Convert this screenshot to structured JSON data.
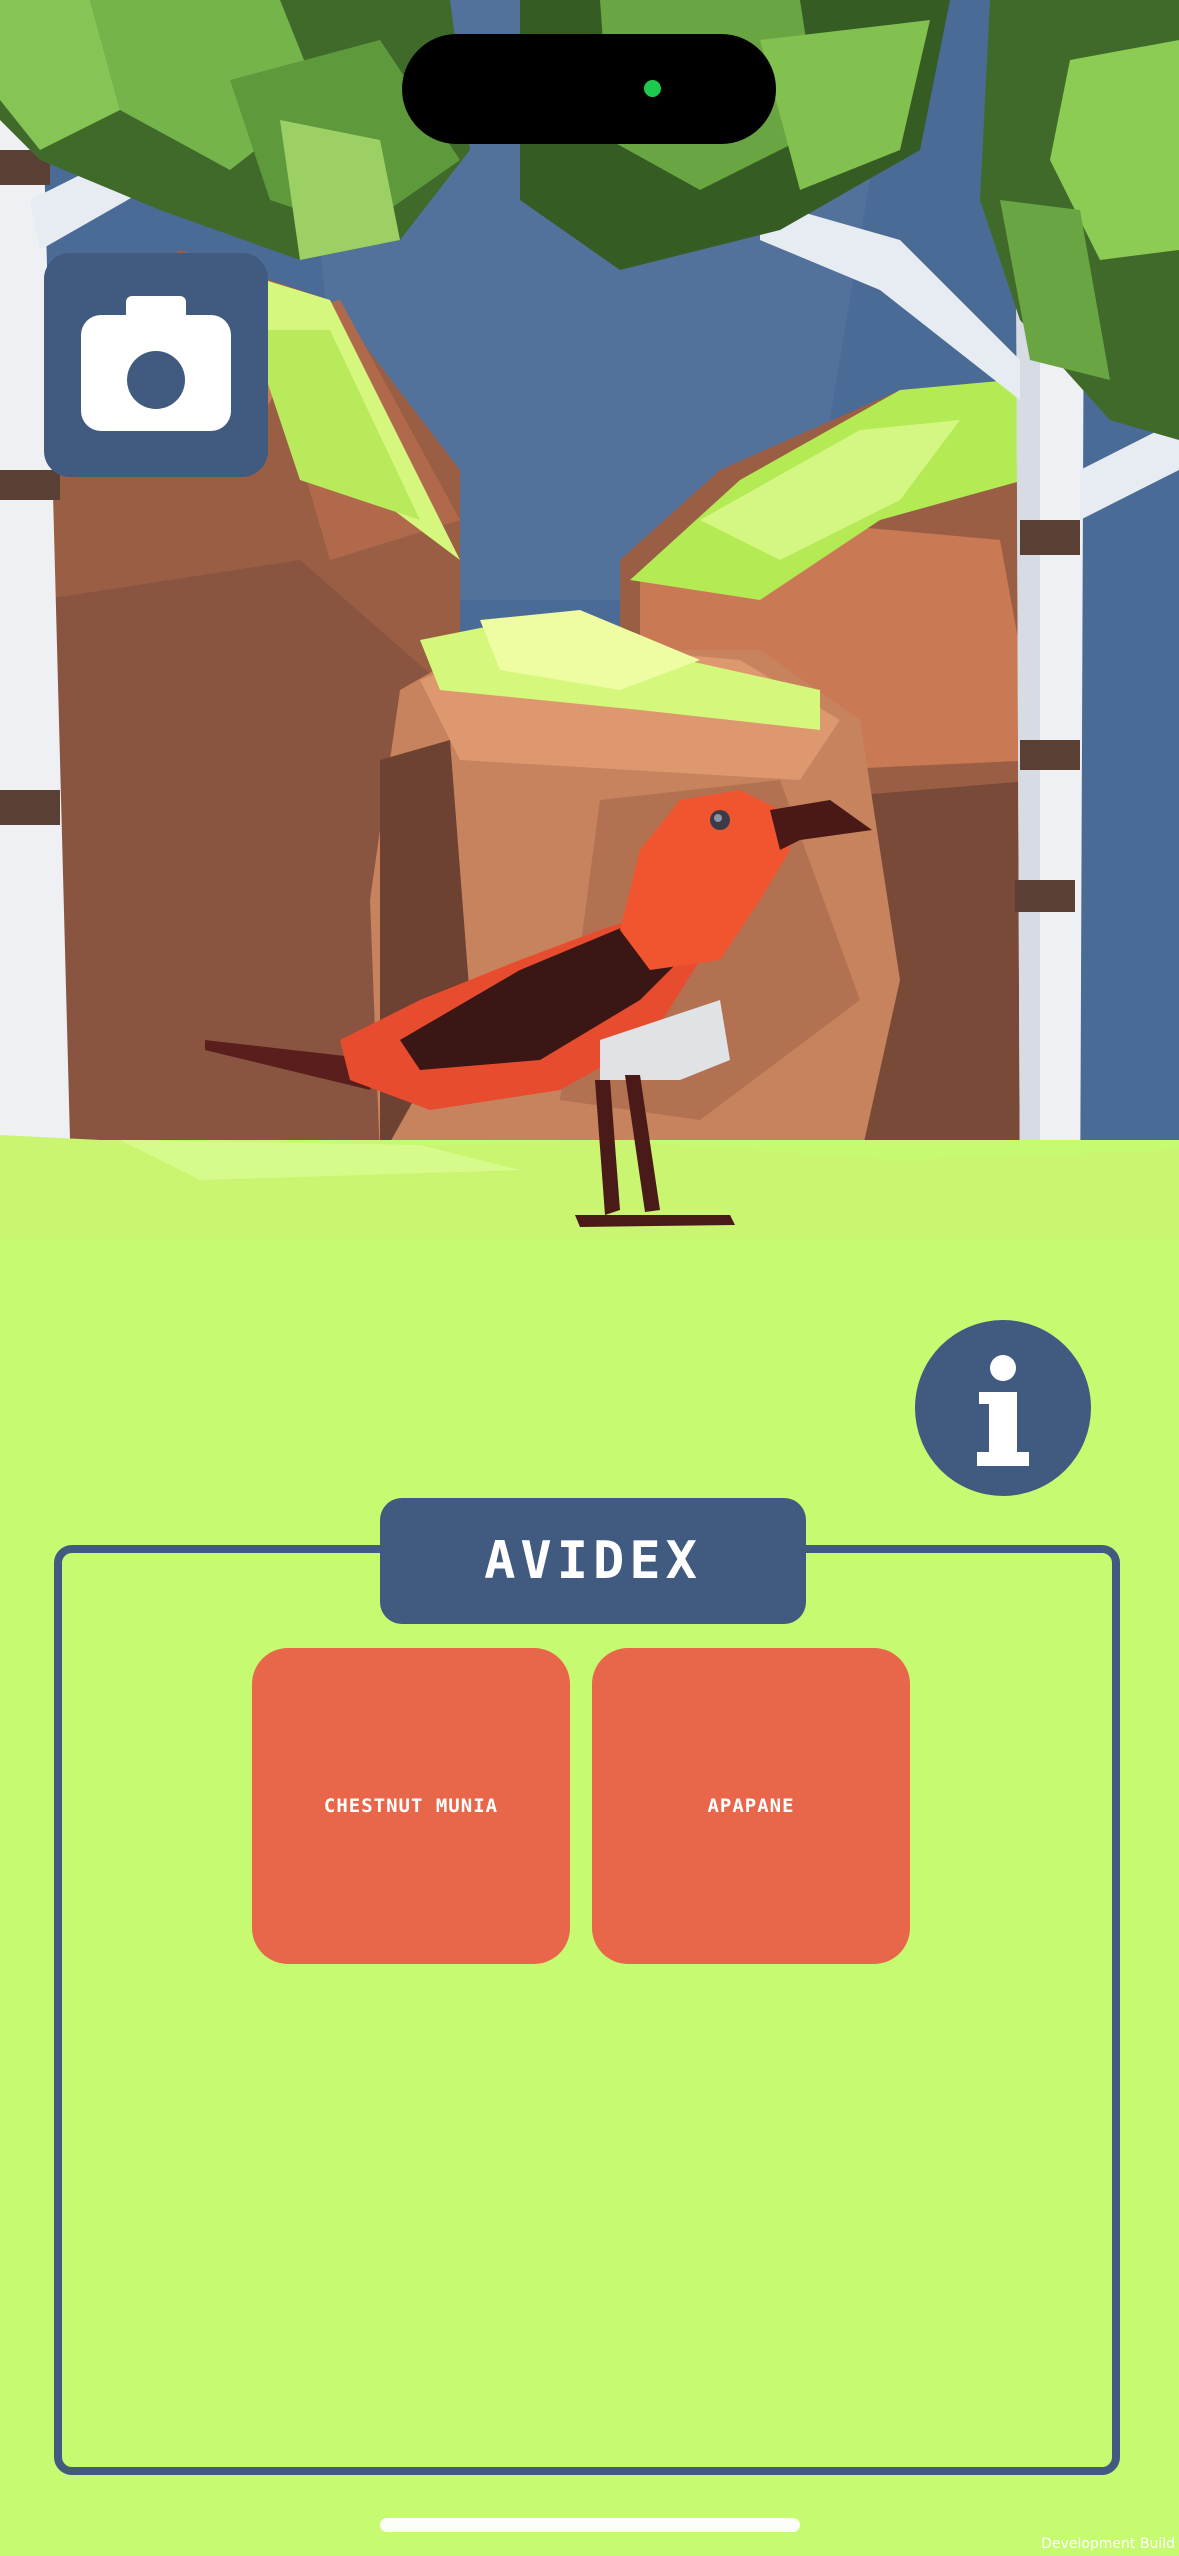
{
  "app": {
    "camera_button": {
      "icon": "camera-icon"
    },
    "info_button": {
      "icon": "info-icon"
    },
    "avidex": {
      "title": "AVIDEX",
      "birds": [
        {
          "name": "CHESTNUT MUNIA"
        },
        {
          "name": "APAPANE"
        }
      ]
    },
    "footer_text": "Development Build"
  },
  "colors": {
    "sky": "#4a6b95",
    "ground": "#c6fa70",
    "button": "#405a80",
    "card": "#e8674a",
    "bird": "#e84c2e"
  }
}
